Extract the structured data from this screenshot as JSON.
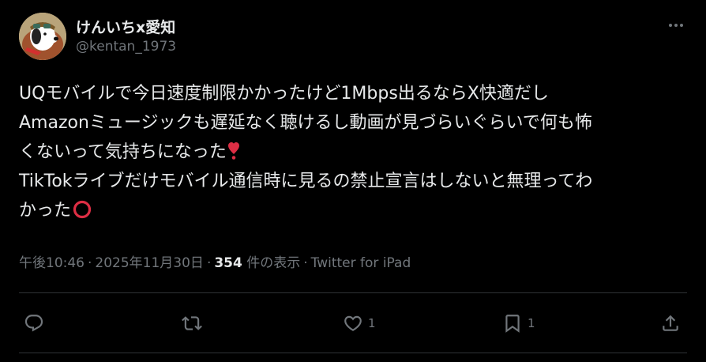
{
  "author": {
    "display_name": "けんいちx愛知",
    "handle": "@kentan_1973",
    "avatar_icon": "snoopy-avatar"
  },
  "tweet": {
    "lines": [
      "UQモバイルで今日速度制限かかったけど1Mbps出るならX快適だし",
      "Amazonミュージックも遅延なく聴けるし動画が見づらいぐらいで何も怖",
      "くないって気持ちになった",
      "TikTokライブだけモバイル通信時に見るの禁止宣言はしないと無理ってわ",
      "かった"
    ],
    "emoji": {
      "heart": "heavy-exclamation-heart",
      "circle": "heavy-large-circle"
    }
  },
  "meta": {
    "time": "午後10:46",
    "date": "2025年11月30日",
    "views_count": "354",
    "views_label": "件の表示",
    "source": "Twitter for iPad",
    "separator": "·"
  },
  "actions": {
    "reply_count": "",
    "retweet_count": "",
    "like_count": "1",
    "bookmark_count": "1"
  },
  "colors": {
    "background": "#000000",
    "text": "#e7e9ea",
    "secondary": "#71767b",
    "divider": "#2f3336",
    "heart_emoji": "#dd2e44"
  }
}
